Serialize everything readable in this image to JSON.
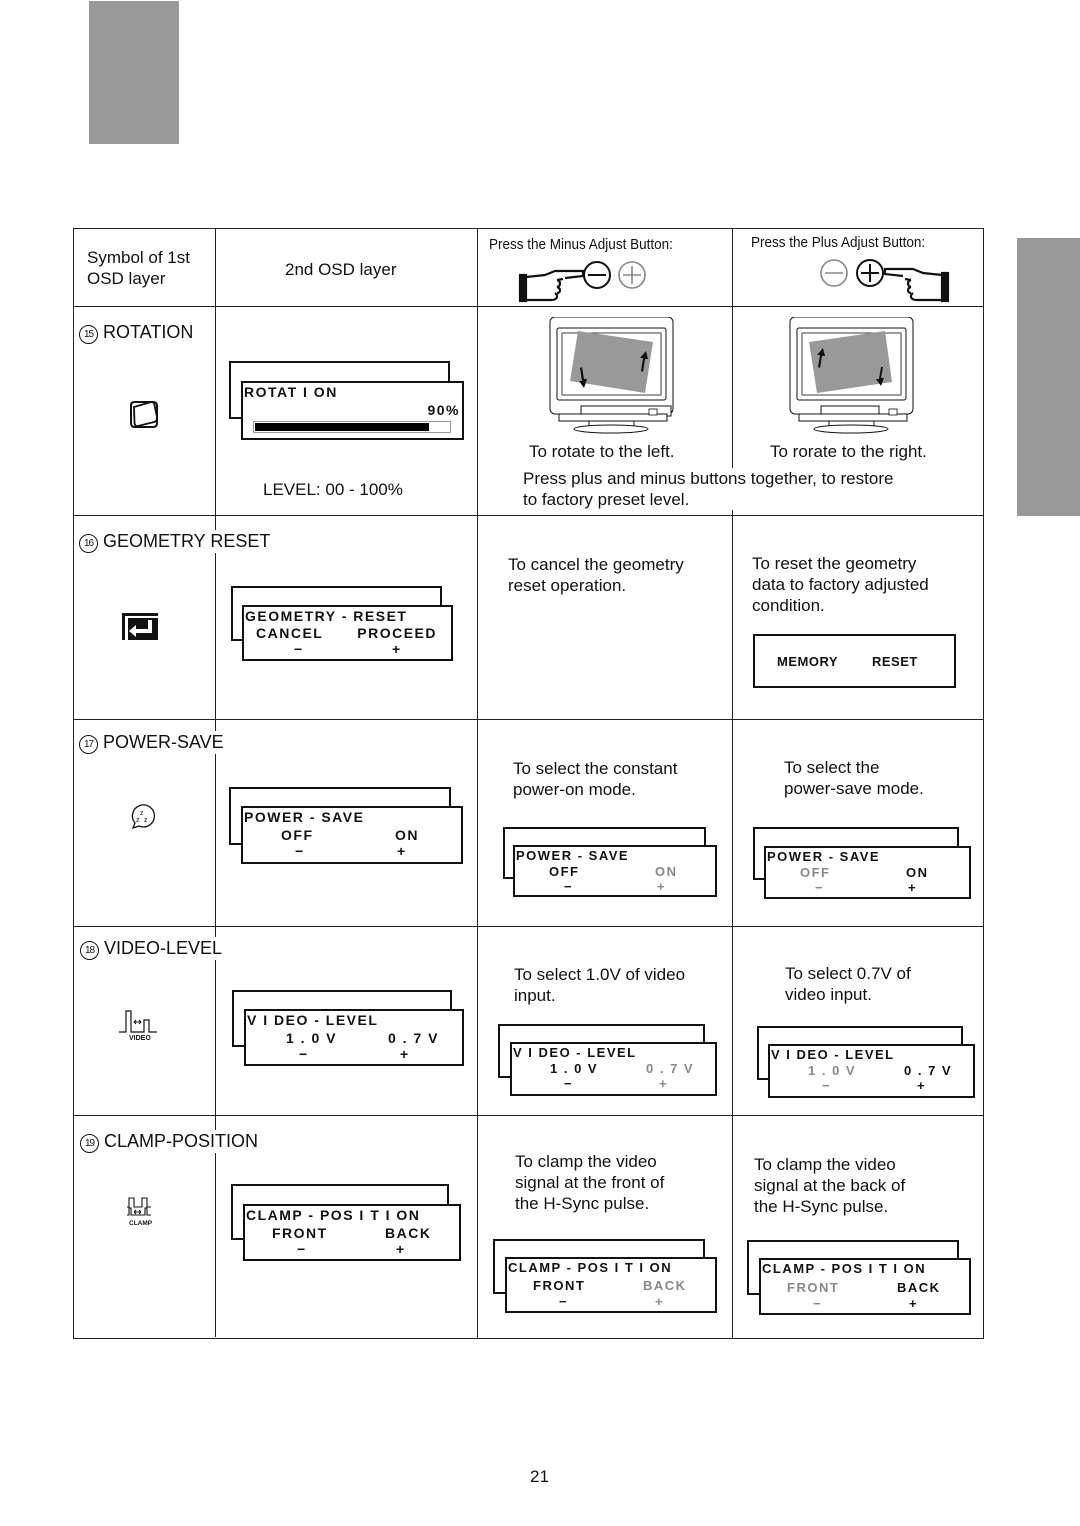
{
  "page_number": "21",
  "header": {
    "col1": "Symbol of 1st OSD layer",
    "col1_line1": "Symbol of 1st",
    "col1_line2": "OSD layer",
    "col2": "2nd OSD layer",
    "col3": "Press the Minus Adjust Button:",
    "col4": "Press the Plus Adjust Button:",
    "col3_icons": [
      "pointing-hand-icon",
      "minus-circle-icon",
      "plus-circle-icon"
    ],
    "col4_icons": [
      "minus-circle-icon",
      "plus-circle-icon",
      "pointing-hand-icon"
    ]
  },
  "rows": [
    {
      "number": "15",
      "title": "ROTATION",
      "icon": "rotation-icon",
      "osd": {
        "title": "ROTAT I ON",
        "value": "90%",
        "progress_percent": 90
      },
      "level": "LEVEL: 00 - 100%",
      "minus_caption": "To rotate to the left.",
      "plus_caption": "To rorate to the right.",
      "note_line1": "Press plus and minus buttons together, to restore",
      "note_line2": "to factory preset level."
    },
    {
      "number": "16",
      "title": "GEOMETRY RESET",
      "icon": "enter-return-icon",
      "osd": {
        "title": "GEOMETRY - RESET",
        "left": "CANCEL",
        "right": "PROCEED",
        "minus": "−",
        "plus": "+"
      },
      "minus_text": [
        "To cancel the geometry",
        "reset operation."
      ],
      "plus_text": [
        "To reset the geometry",
        "data to factory adjusted",
        "condition."
      ],
      "plus_box": {
        "left": "MEMORY",
        "right": "RESET"
      }
    },
    {
      "number": "17",
      "title": "POWER-SAVE",
      "icon": "sleep-zzz-icon",
      "osd": {
        "title": "POWER - SAVE",
        "left": "OFF",
        "right": "ON",
        "minus": "−",
        "plus": "+"
      },
      "minus_text": [
        "To select the constant",
        "power-on mode."
      ],
      "plus_text": [
        "To select the",
        "power-save mode."
      ],
      "minus_selected": "OFF",
      "plus_selected": "ON"
    },
    {
      "number": "18",
      "title": "VIDEO-LEVEL",
      "icon": "video-level-icon",
      "icon_label": "VIDEO",
      "osd": {
        "title": "V I DEO - LEVEL",
        "left": "1 . 0 V",
        "right": "0 . 7 V",
        "minus": "−",
        "plus": "+"
      },
      "minus_text": [
        "To select 1.0V of video",
        "input."
      ],
      "plus_text": [
        "To select 0.7V of",
        "video input."
      ],
      "minus_selected": "1.0V",
      "plus_selected": "0.7V"
    },
    {
      "number": "19",
      "title": "CLAMP-POSITION",
      "icon": "clamp-icon",
      "icon_label": "CLAMP",
      "osd": {
        "title": "CLAMP - POS I T I ON",
        "left": "FRONT",
        "right": "BACK",
        "minus": "−",
        "plus": "+"
      },
      "minus_text": [
        "To clamp the video",
        "signal at the front of",
        "the H-Sync pulse."
      ],
      "plus_text": [
        "To clamp the video",
        "signal at the back of",
        "the H-Sync pulse."
      ],
      "minus_selected": "FRONT",
      "plus_selected": "BACK"
    }
  ]
}
